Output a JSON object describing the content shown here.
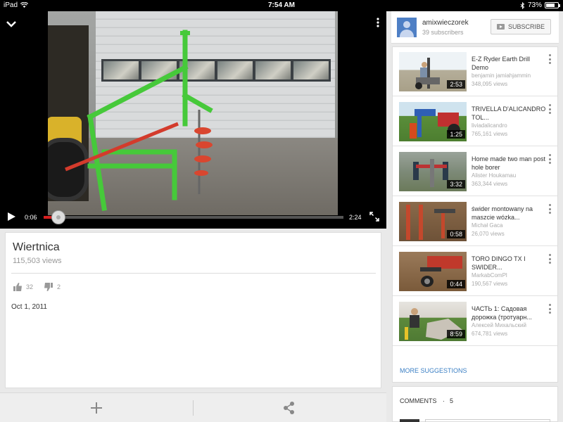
{
  "status_bar": {
    "device": "iPad",
    "time": "7:54 AM",
    "battery": "73%",
    "battery_level": 0.73
  },
  "player": {
    "current_time": "0:06",
    "total_time": "2:24",
    "progress": 0.05
  },
  "video": {
    "title": "Wiertnica",
    "views": "115,503 views",
    "likes": "32",
    "dislikes": "2",
    "published": "Oct 1, 2011"
  },
  "channel": {
    "name": "amixwieczorek",
    "subscribers": "39 subscribers",
    "subscribe_label": "SUBSCRIBE"
  },
  "suggestions": {
    "items": [
      {
        "title": "E-Z Ryder Earth Drill Demo",
        "author": "benjamin jamiahjammin",
        "views": "348,095 views",
        "duration": "2:53"
      },
      {
        "title": "TRIVELLA D'ALICANDRO TOL...",
        "author": "liviadalicandro",
        "views": "765,161 views",
        "duration": "1:25"
      },
      {
        "title": "Home made two man post hole borer",
        "author": "Alister Houkamau",
        "views": "363,344 views",
        "duration": "3:32"
      },
      {
        "title": "świder montowany na maszcie wózka...",
        "author": "Michał Gaca",
        "views": "26,070 views",
        "duration": "0:58"
      },
      {
        "title": "TORO DINGO TX I SWIDER...",
        "author": "MarkabComPl",
        "views": "190,567 views",
        "duration": "0:44"
      },
      {
        "title": "ЧАСТЬ 1: Садовая дорожка (тротуарн...",
        "author": "Алексей Михальский",
        "views": "674,781 views",
        "duration": "8:59"
      }
    ],
    "more_label": "MORE SUGGESTIONS"
  },
  "comments": {
    "label": "COMMENTS",
    "separator": "·",
    "count": "5"
  },
  "colors": {
    "progress_red": "#d81f1f",
    "link_blue": "#3a7fc4",
    "drill_green": "#46c93a"
  }
}
